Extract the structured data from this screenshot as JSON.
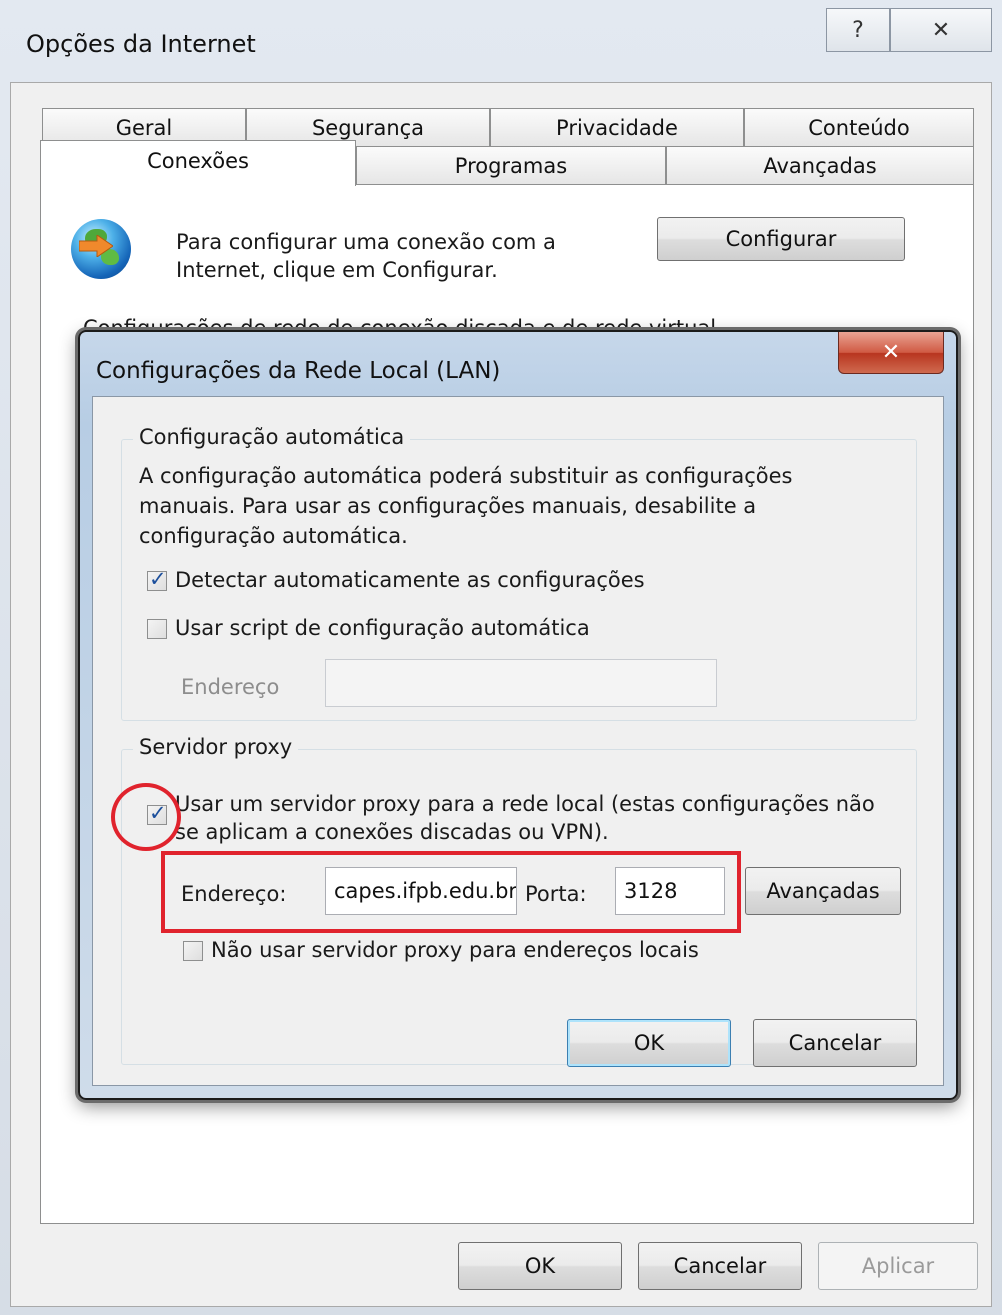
{
  "outer_window": {
    "title": "Opções da Internet",
    "help_glyph": "?",
    "close_glyph": "✕"
  },
  "tabs": {
    "row1": [
      "Geral",
      "Segurança",
      "Privacidade",
      "Conteúdo"
    ],
    "row2": [
      "Conexões",
      "Programas",
      "Avançadas"
    ],
    "active": "Conexões"
  },
  "connections": {
    "setup_text_line1": "Para configurar uma conexão com a",
    "setup_text_line2": "Internet, clique em Configurar.",
    "setup_button": "Configurar",
    "hidden_section_label": "Configurações de rede de conexão discada e de rede virtual"
  },
  "lan_dialog": {
    "title": "Configurações da Rede Local (LAN)",
    "close_glyph": "✕",
    "auto_config": {
      "legend": "Configuração automática",
      "description_line1": "A configuração automática poderá substituir as configurações",
      "description_line2": "manuais. Para usar as configurações manuais, desabilite a",
      "description_line3": "configuração automática.",
      "detect_label": "Detectar automaticamente as configurações",
      "detect_checked": true,
      "script_label": "Usar script de configuração automática",
      "script_checked": false,
      "address_label": "Endereço",
      "address_value": ""
    },
    "proxy": {
      "legend": "Servidor proxy",
      "use_proxy_line1": "Usar um servidor proxy para a rede local (estas configurações não",
      "use_proxy_line2": "se aplicam a conexões discadas ou VPN).",
      "use_proxy_checked": true,
      "address_label": "Endereço:",
      "address_value": "capes.ifpb.edu.br",
      "port_label": "Porta:",
      "port_value": "3128",
      "advanced_button": "Avançadas",
      "bypass_label": "Não usar servidor proxy para endereços locais",
      "bypass_checked": false
    },
    "ok_button": "OK",
    "cancel_button": "Cancelar"
  },
  "footer": {
    "ok_button": "OK",
    "cancel_button": "Cancelar",
    "apply_button": "Aplicar"
  },
  "colors": {
    "annotation": "#e0232d",
    "dialog_frame": "#b7cde4",
    "close_button": "#c94a33"
  }
}
